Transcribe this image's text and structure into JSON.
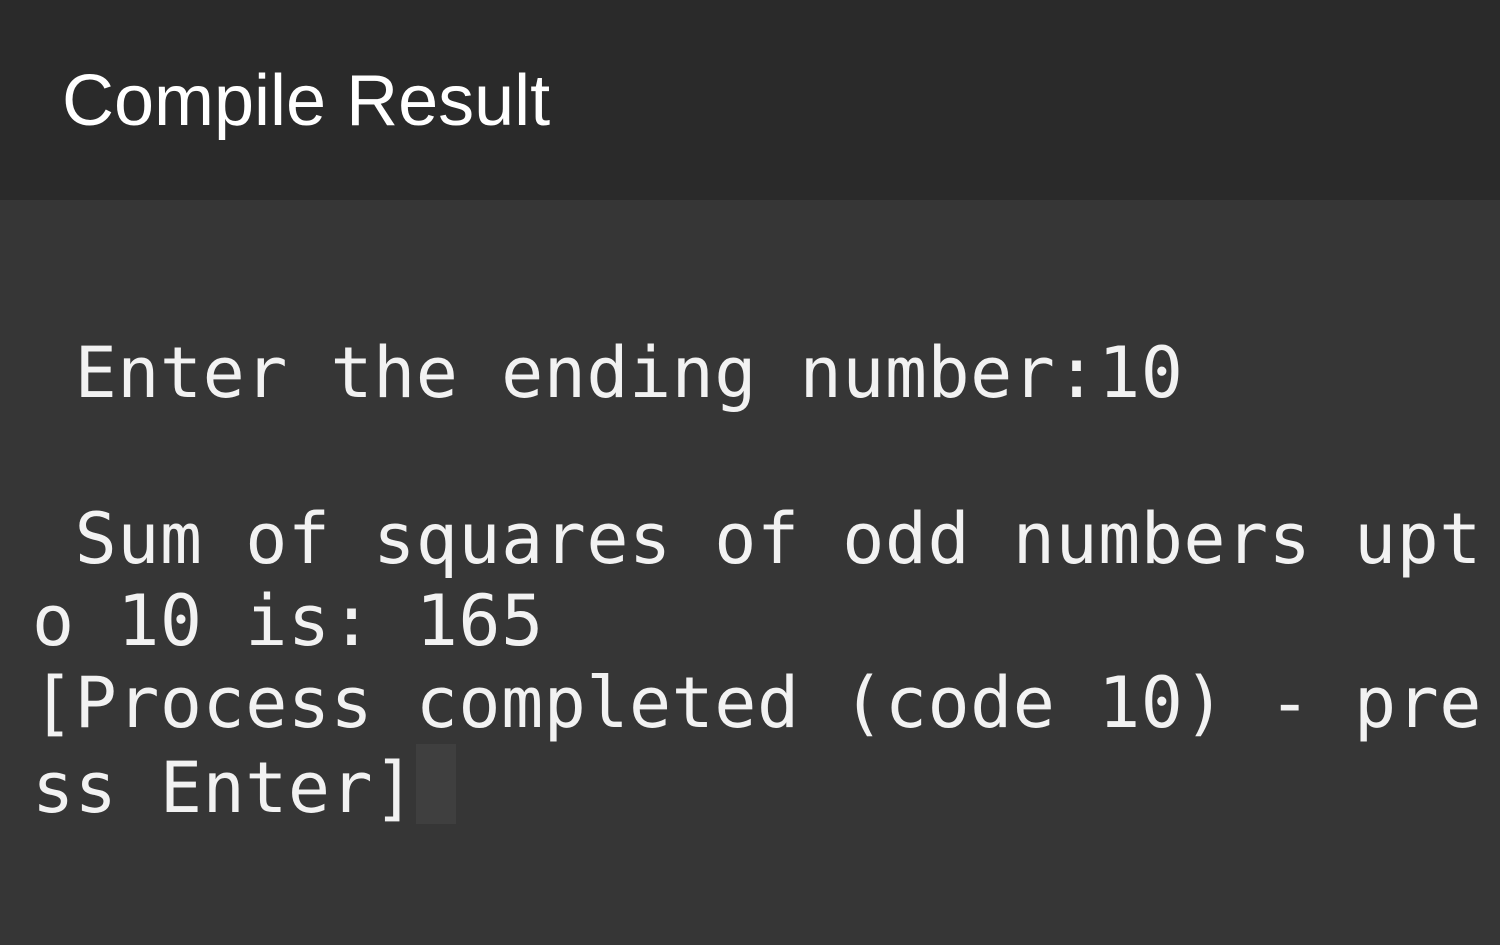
{
  "header": {
    "title": "Compile Result"
  },
  "console": {
    "lines": [
      " Enter the ending number:10",
      " Sum of squares of odd numbers upt",
      "o 10 is: 165",
      "[Process completed (code 10) - pre",
      "ss Enter]"
    ]
  },
  "colors": {
    "header_bg": "#2a2a2a",
    "console_bg": "#363636",
    "text": "#f2f2f2",
    "cursor": "#3f3f3f"
  }
}
